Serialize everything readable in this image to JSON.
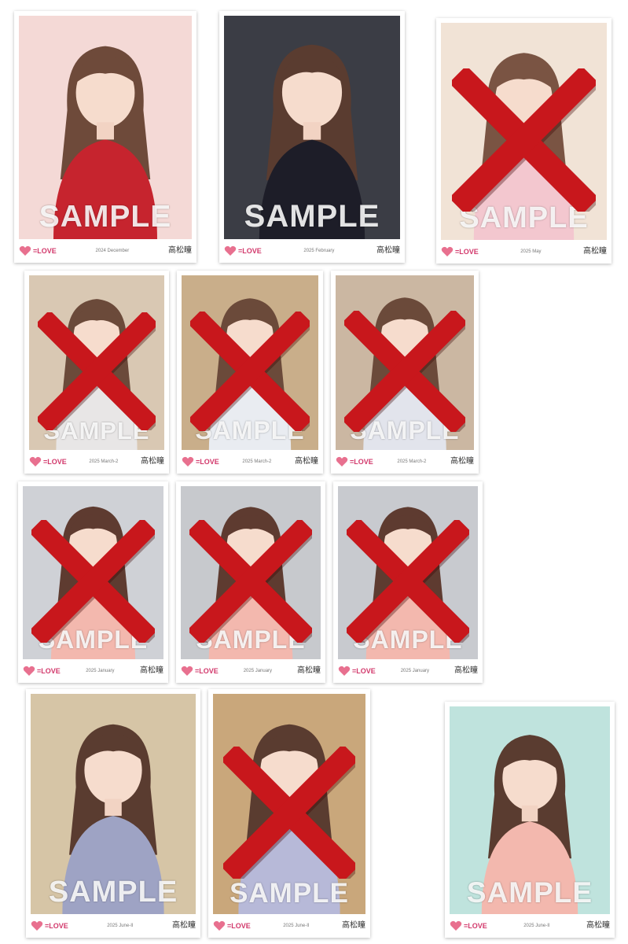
{
  "watermark": "SAMPLE",
  "member_name": "高松瞳",
  "group_logo": "=LOVE",
  "accent": "#c8171c",
  "cards": [
    {
      "date": "2024 December",
      "crossed": false,
      "bg": "#f4d9d6",
      "top": "#c6242e",
      "hair": "#6e4a3a"
    },
    {
      "date": "2025 February",
      "crossed": false,
      "bg": "#3b3d45",
      "top": "#1d1d28",
      "hair": "#5a3c30"
    },
    {
      "date": "2025 May",
      "crossed": true,
      "bg": "#f1e3d6",
      "top": "#f3c7cf",
      "hair": "#7a5443"
    },
    {
      "date": "2025 March-2",
      "crossed": true,
      "bg": "#d9c8b3",
      "top": "#e8e6e6",
      "hair": "#6b4a3a"
    },
    {
      "date": "2025 March-2",
      "crossed": true,
      "bg": "#c9ae8a",
      "top": "#e9ecf1",
      "hair": "#6b4a3a"
    },
    {
      "date": "2025 March-2",
      "crossed": true,
      "bg": "#cbb7a2",
      "top": "#e2e4ec",
      "hair": "#6b4a3a"
    },
    {
      "date": "2025 January",
      "crossed": true,
      "bg": "#cfd1d6",
      "top": "#f3b8ae",
      "hair": "#5e3b30"
    },
    {
      "date": "2025 January",
      "crossed": true,
      "bg": "#c7c9cd",
      "top": "#f3b8ae",
      "hair": "#5e3b30"
    },
    {
      "date": "2025 January",
      "crossed": true,
      "bg": "#c8cacf",
      "top": "#f3b8ae",
      "hair": "#5e3b30"
    },
    {
      "date": "2025 June-II",
      "crossed": false,
      "bg": "#d6c5a6",
      "top": "#9ea3c4",
      "hair": "#5a3c30"
    },
    {
      "date": "2025 June-II",
      "crossed": true,
      "bg": "#c9a77b",
      "top": "#b7b9d8",
      "hair": "#5a3c30"
    },
    {
      "date": "2025 June-II",
      "crossed": false,
      "bg": "#bfe3dd",
      "top": "#f3b8ae",
      "hair": "#5a3c30"
    }
  ]
}
